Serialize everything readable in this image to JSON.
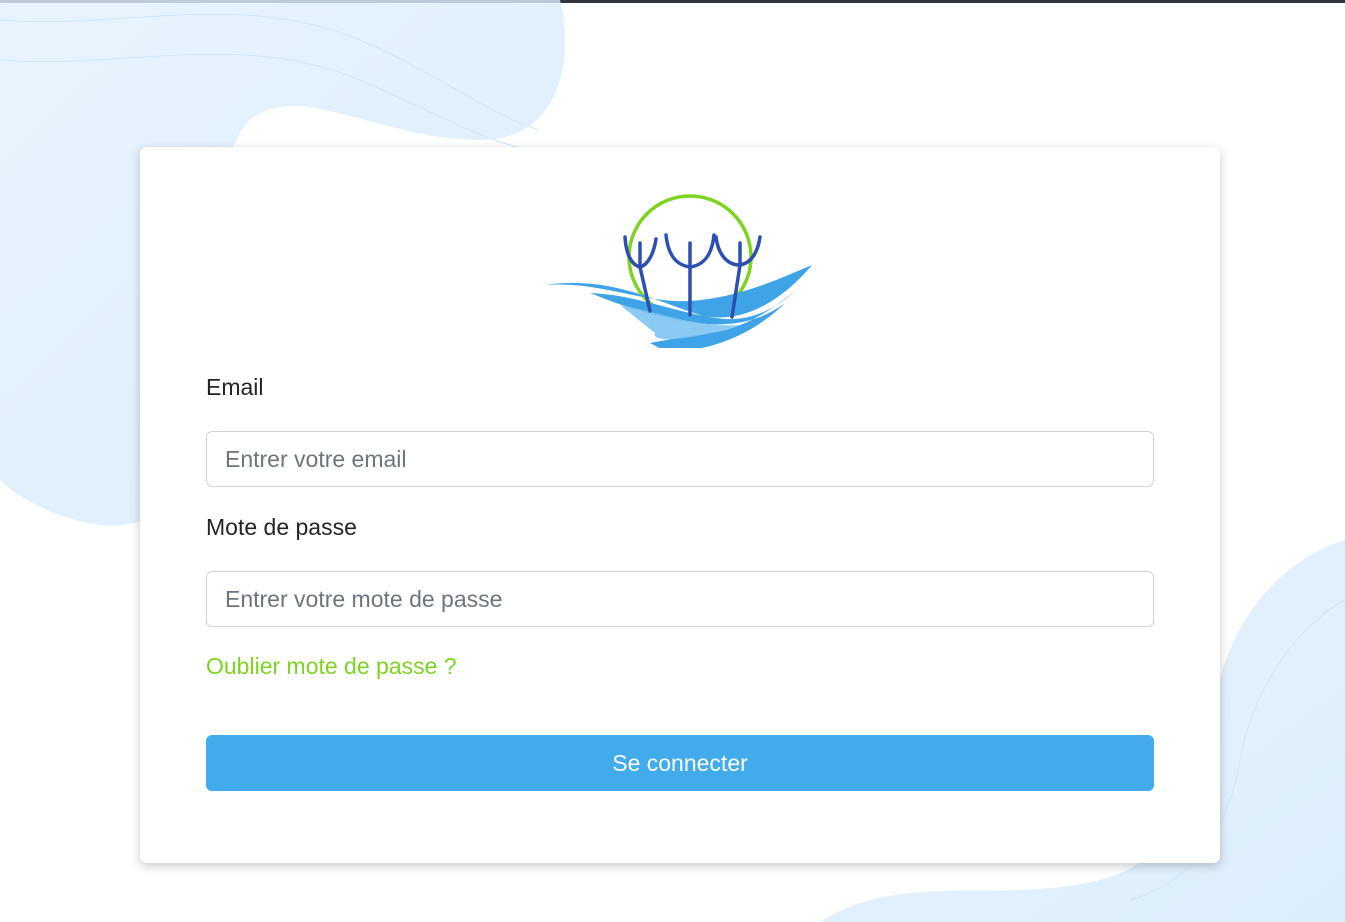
{
  "login": {
    "email_label": "Email",
    "email_placeholder": "Entrer votre email",
    "password_label": "Mote de passe",
    "password_placeholder": "Entrer votre mote de passe",
    "forgot_link": "Oublier mote de passe ?",
    "submit_label": "Se connecter"
  },
  "colors": {
    "accent_blue": "#41abec",
    "link_green": "#7ed321",
    "logo_blue_dark": "#2d4fb0",
    "logo_blue_light": "#3fa3e8",
    "logo_green": "#7ed321"
  },
  "icons": {
    "logo": "trees-in-circle-over-waves-logo"
  }
}
